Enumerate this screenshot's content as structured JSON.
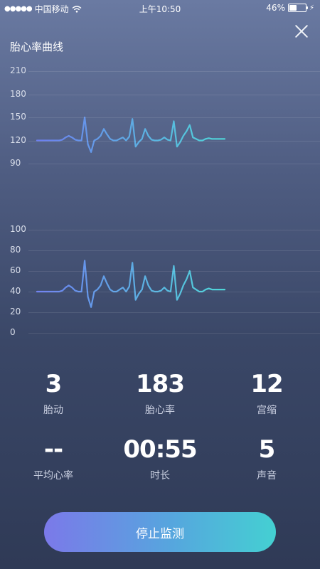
{
  "status_bar": {
    "carrier": "中国移动",
    "time": "上午10:50",
    "battery": "46%"
  },
  "page": {
    "title": "胎心率曲线"
  },
  "colors": {
    "line_start": "#6d7ff0",
    "line_end": "#4fd6d8",
    "button_start": "#7b79e9",
    "button_end": "#44d0d2"
  },
  "chart_data": [
    {
      "type": "line",
      "title": "",
      "ylim": [
        90,
        210
      ],
      "yticks": [
        210,
        180,
        150,
        120,
        90
      ],
      "grid": true,
      "series": [
        {
          "values": [
            120,
            120,
            120,
            120,
            120,
            120,
            120,
            120,
            121,
            124,
            126,
            124,
            121,
            120,
            120,
            150,
            115,
            105,
            120,
            122,
            126,
            135,
            128,
            122,
            120,
            120,
            122,
            124,
            120,
            125,
            148,
            112,
            118,
            122,
            135,
            126,
            121,
            120,
            120,
            121,
            124,
            121,
            120,
            145,
            112,
            118,
            126,
            132,
            140,
            124,
            122,
            120,
            120,
            122,
            123,
            122,
            122,
            122,
            122,
            122
          ]
        }
      ]
    },
    {
      "type": "line",
      "title": "",
      "ylim": [
        0,
        100
      ],
      "yticks": [
        100,
        80,
        60,
        40,
        20,
        0
      ],
      "grid": true,
      "series": [
        {
          "values": [
            40,
            40,
            40,
            40,
            40,
            40,
            40,
            40,
            41,
            44,
            46,
            44,
            41,
            40,
            40,
            70,
            35,
            25,
            40,
            42,
            46,
            55,
            48,
            42,
            40,
            40,
            42,
            44,
            40,
            45,
            68,
            32,
            38,
            42,
            55,
            46,
            41,
            40,
            40,
            41,
            44,
            41,
            40,
            65,
            32,
            38,
            46,
            52,
            60,
            44,
            42,
            40,
            40,
            42,
            43,
            42,
            42,
            42,
            42,
            42
          ]
        }
      ]
    }
  ],
  "stats": [
    {
      "value": "3",
      "label": "胎动"
    },
    {
      "value": "183",
      "label": "胎心率"
    },
    {
      "value": "12",
      "label": "宫缩"
    },
    {
      "value": "--",
      "label": "平均心率"
    },
    {
      "value": "00:55",
      "label": "时长"
    },
    {
      "value": "5",
      "label": "声音"
    }
  ],
  "stop_button_label": "停止监测"
}
